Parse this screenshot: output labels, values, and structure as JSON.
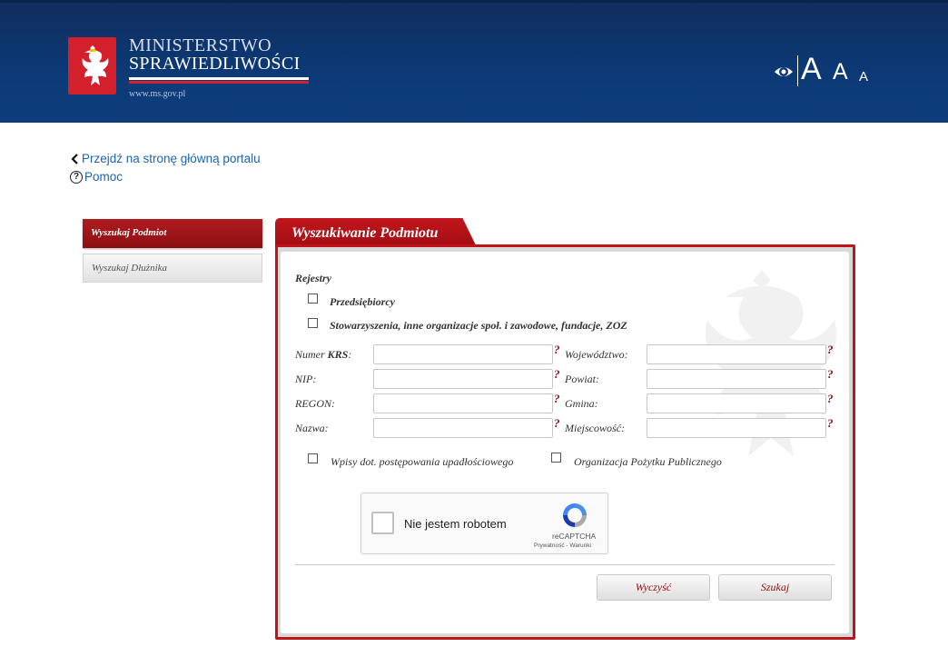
{
  "header": {
    "logo_line1": "MINISTERSTWO",
    "logo_line2": "SPRAWIEDLIWOŚCI",
    "logo_url": "www.ms.gov.pl",
    "font_size_large": "A",
    "font_size_medium": "A",
    "font_size_small": "A",
    "colors": {
      "background": "#0c3a77",
      "accent": "#d4202c"
    }
  },
  "nav": {
    "back_link": "Przejdź na stronę główną portalu",
    "help_link": "Pomoc",
    "help_icon_glyph": "?"
  },
  "sidebar": {
    "items": [
      {
        "label": "Wyszukaj Podmiot",
        "active": true
      },
      {
        "label": "Wyszukaj Dłużnika",
        "active": false
      }
    ]
  },
  "form": {
    "tab_title": "Wyszukiwanie Podmiotu",
    "registers_title": "Rejestry",
    "registers": [
      {
        "label": "Przedsiębiorcy",
        "checked": false
      },
      {
        "label": "Stowarzyszenia, inne organizacje społ. i zawodowe, fundacje, ZOZ",
        "checked": false
      }
    ],
    "fields_left": [
      {
        "label_prefix": "Numer ",
        "label_bold": "KRS",
        "label_suffix": ":",
        "value": ""
      },
      {
        "label_prefix": "NIP:",
        "label_bold": "",
        "label_suffix": "",
        "value": ""
      },
      {
        "label_prefix": "REGON:",
        "label_bold": "",
        "label_suffix": "",
        "value": ""
      },
      {
        "label_prefix": "Nazwa:",
        "label_bold": "",
        "label_suffix": "",
        "value": ""
      }
    ],
    "fields_right": [
      {
        "label": "Województwo:",
        "value": ""
      },
      {
        "label": "Powiat:",
        "value": ""
      },
      {
        "label": "Gmina:",
        "value": ""
      },
      {
        "label": "Miejscowość:",
        "value": ""
      }
    ],
    "help_mark": "?",
    "option_bankruptcy": {
      "label": "Wpisy dot. postępowania upadłościowego",
      "checked": false
    },
    "option_public_benefit": {
      "label": "Organizacja Pożytku Publicznego",
      "checked": false
    },
    "captcha": {
      "label": "Nie jestem robotem",
      "brand": "reCAPTCHA",
      "links": "Prywatność - Warunki"
    },
    "clear_button": "Wyczyść",
    "search_button": "Szukaj"
  }
}
